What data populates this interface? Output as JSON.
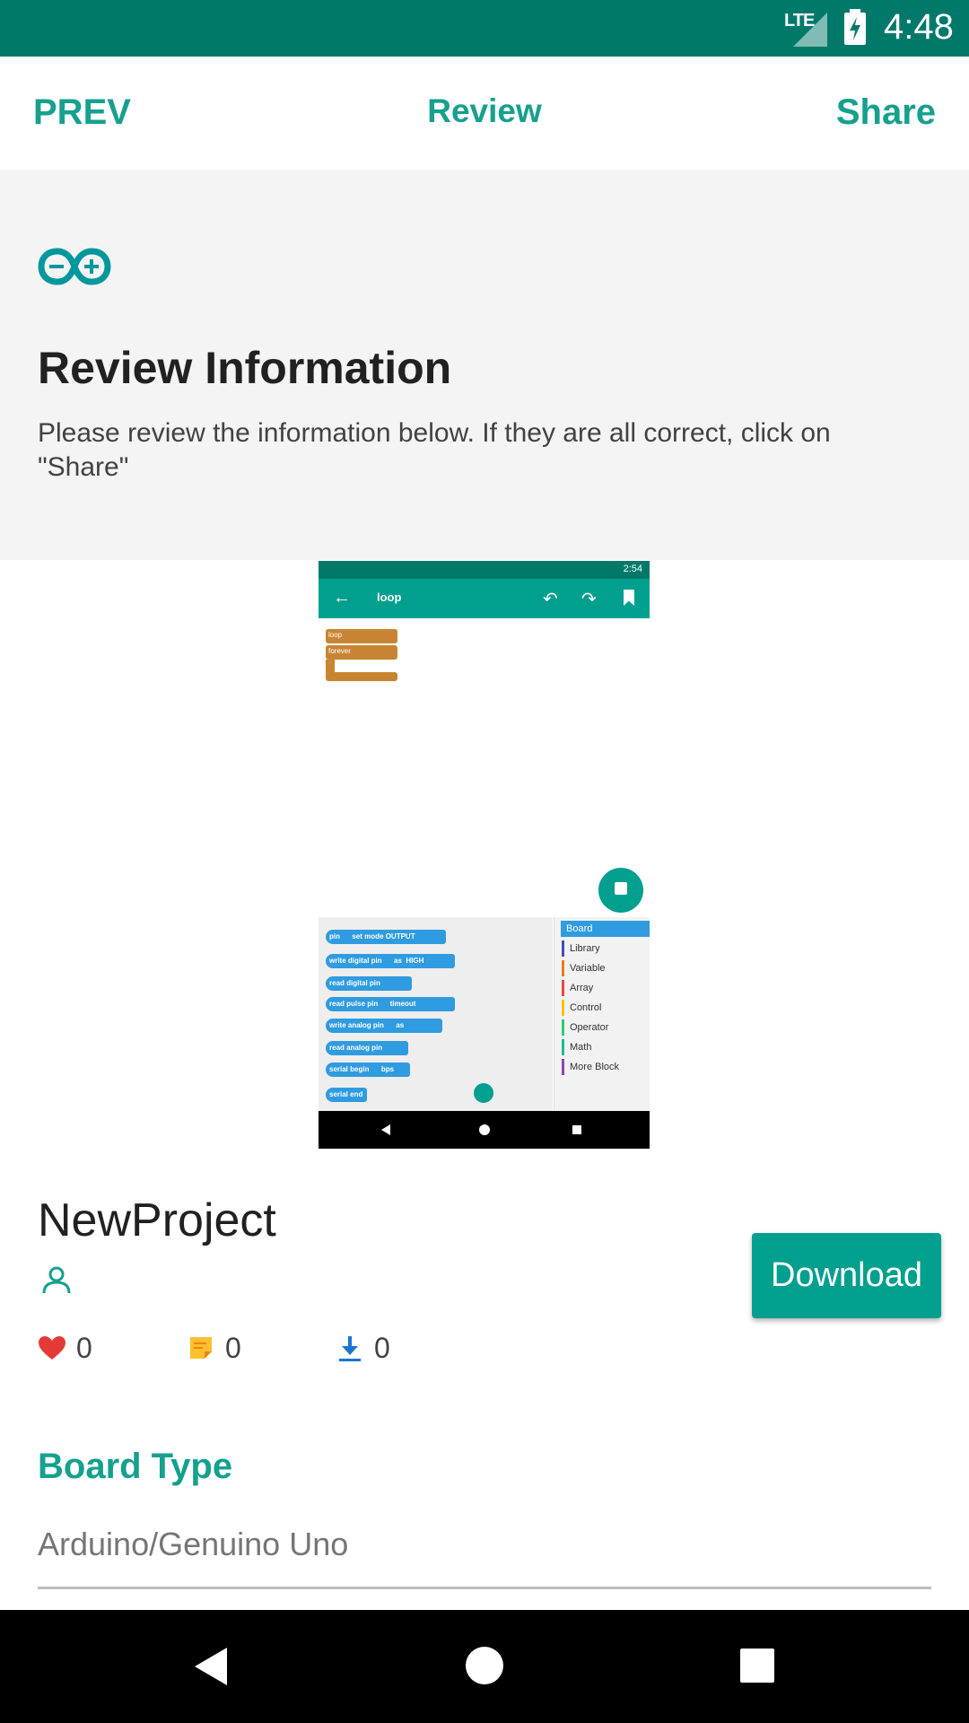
{
  "status_bar": {
    "network": "LTE",
    "time": "4:48"
  },
  "nav": {
    "prev_label": "PREV",
    "title": "Review",
    "share_label": "Share"
  },
  "header": {
    "title": "Review Information",
    "description": "Please review the information below. If they are all correct, click on \"Share\""
  },
  "preview": {
    "status_time": "2:54",
    "toolbar_title": "loop",
    "canvas_blocks": [
      "loop",
      "forever"
    ],
    "palette_blocks": [
      "pin",
      "set mode",
      "OUTPUT",
      "write digital pin",
      "as",
      "HIGH",
      "read digital pin",
      "read pulse pin",
      "timeout",
      "write analog pin",
      "as",
      "read analog pin",
      "serial begin",
      "bps",
      "serial end"
    ],
    "categories": [
      "Board",
      "Library",
      "Variable",
      "Array",
      "Control",
      "Operator",
      "Math",
      "More Block"
    ],
    "category_colors": [
      "#2F9BE0",
      "#3F51B5",
      "#E67E22",
      "#E74C3C",
      "#F1C40F",
      "#2ECC71",
      "#1ABC9C",
      "#8E44AD"
    ]
  },
  "project": {
    "name": "NewProject",
    "likes": "0",
    "comments": "0",
    "downloads": "0",
    "download_label": "Download"
  },
  "board": {
    "label": "Board Type",
    "value": "Arduino/Genuino Uno"
  },
  "colors": {
    "primary": "#009F8E",
    "primary_dark": "#00796B",
    "accent_text": "#16A08E"
  }
}
